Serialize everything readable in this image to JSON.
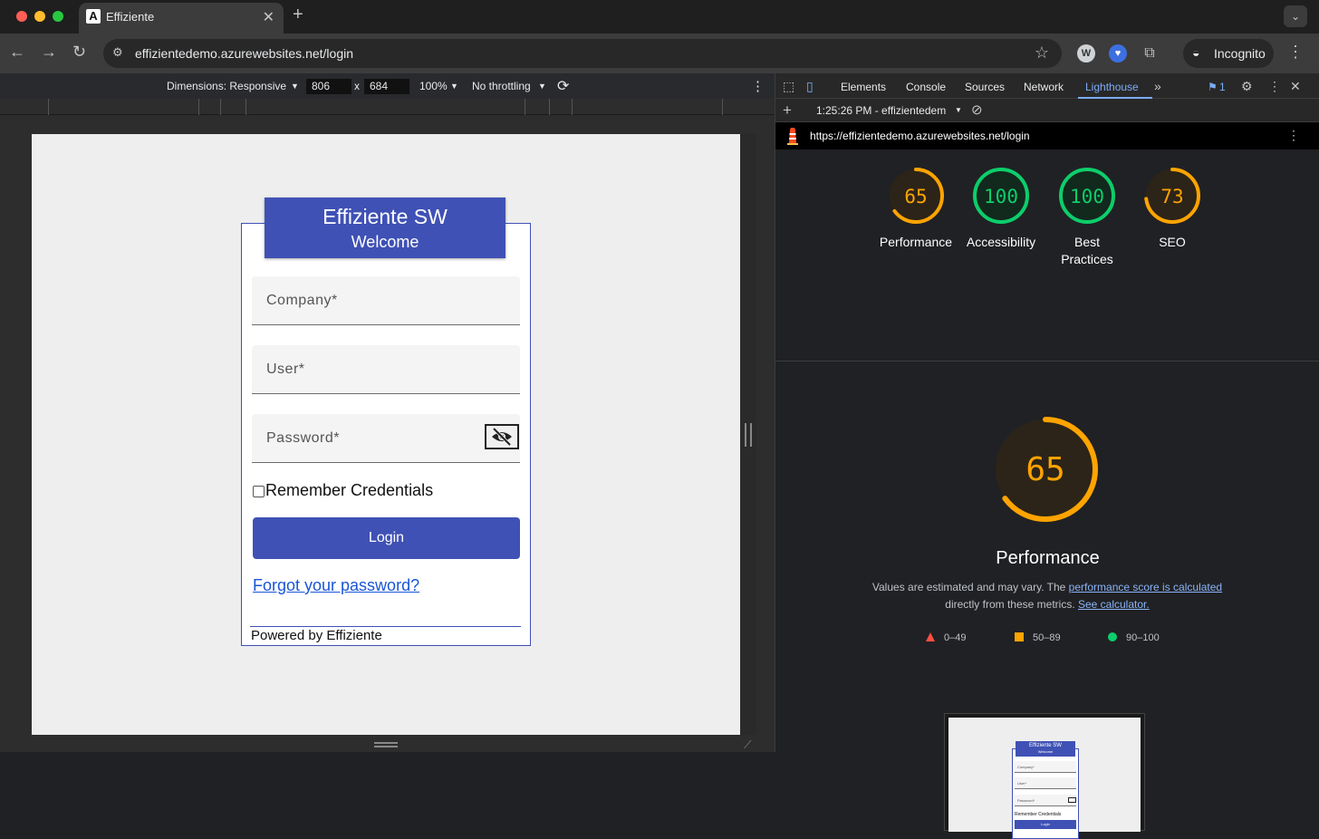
{
  "browser": {
    "tab_title": "Effiziente",
    "tab_favicon_letter": "A",
    "url": "effizientedemo.azurewebsites.net/login",
    "incognito_label": "Incognito",
    "extension_w_label": "W"
  },
  "device_toolbar": {
    "dimensions_label": "Dimensions: Responsive",
    "width": "806",
    "times": "x",
    "height": "684",
    "zoom": "100%",
    "throttling": "No throttling"
  },
  "login": {
    "title": "Effiziente SW",
    "subtitle": "Welcome",
    "company_placeholder": "Company*",
    "user_placeholder": "User*",
    "password_placeholder": "Password*",
    "remember_label": "Remember Credentials",
    "login_button": "Login",
    "forgot_link": "Forgot your password?",
    "footer": "Powered by Effiziente"
  },
  "devtools": {
    "tabs": [
      "Elements",
      "Console",
      "Sources",
      "Network",
      "Lighthouse"
    ],
    "active_tab": "Lighthouse",
    "issues_count": "1",
    "report_time": "1:25:26 PM - effizientedem",
    "report_url": "https://effizientedemo.azurewebsites.net/login",
    "scores": [
      {
        "label": "Performance",
        "value": 65,
        "color": "#ffa400"
      },
      {
        "label": "Accessibility",
        "value": 100,
        "color": "#0cce6b"
      },
      {
        "label": "Best Practices",
        "value": 100,
        "color": "#0cce6b"
      },
      {
        "label": "SEO",
        "value": 73,
        "color": "#ffa400"
      }
    ],
    "main_score": {
      "label": "Performance",
      "value": 65,
      "color": "#ffa400"
    },
    "desc_part1": "Values are estimated and may vary. The ",
    "desc_link1": "performance score is calculated",
    "desc_part2": "directly from these metrics. ",
    "desc_link2": "See calculator.",
    "legend": [
      {
        "range": "0–49",
        "color": "#ff4e42",
        "shape": "triangle"
      },
      {
        "range": "50–89",
        "color": "#ffa400",
        "shape": "square"
      },
      {
        "range": "90–100",
        "color": "#0cce6b",
        "shape": "circle"
      }
    ]
  },
  "thumbnail": {
    "title": "Effiziente SW",
    "subtitle": "Welcome",
    "company": "Company*",
    "user": "User*",
    "password": "Password*",
    "remember": "Remember Credentials",
    "login": "Login"
  }
}
